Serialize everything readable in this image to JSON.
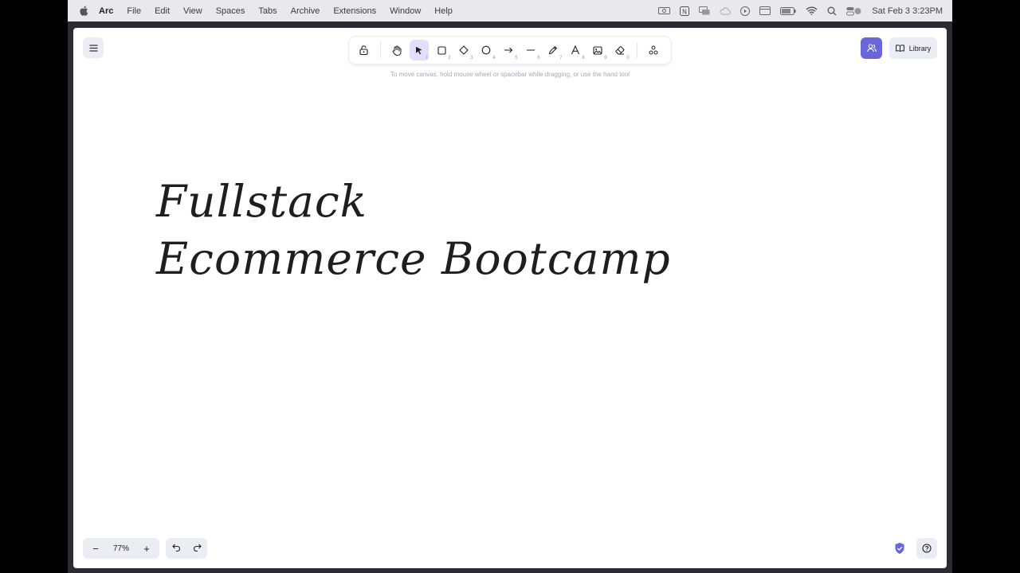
{
  "menubar": {
    "app": "Arc",
    "items": [
      "File",
      "Edit",
      "View",
      "Spaces",
      "Tabs",
      "Archive",
      "Extensions",
      "Window",
      "Help"
    ],
    "clock": "Sat Feb 3  3:23PM"
  },
  "toolbar": {
    "tools": [
      {
        "name": "lock-tool",
        "icon": "lock-icon",
        "key": ""
      },
      {
        "name": "hand-tool",
        "icon": "hand-icon",
        "key": ""
      },
      {
        "name": "selection-tool",
        "icon": "pointer-icon",
        "key": "1",
        "active": true
      },
      {
        "name": "rectangle-tool",
        "icon": "square-icon",
        "key": "2"
      },
      {
        "name": "diamond-tool",
        "icon": "diamond-icon",
        "key": "3"
      },
      {
        "name": "ellipse-tool",
        "icon": "circle-icon",
        "key": "4"
      },
      {
        "name": "arrow-tool",
        "icon": "arrow-icon",
        "key": "5"
      },
      {
        "name": "line-tool",
        "icon": "line-icon",
        "key": "6"
      },
      {
        "name": "draw-tool",
        "icon": "pencil-icon",
        "key": "7"
      },
      {
        "name": "text-tool",
        "icon": "text-icon",
        "key": "8"
      },
      {
        "name": "image-tool",
        "icon": "image-icon",
        "key": "9"
      },
      {
        "name": "eraser-tool",
        "icon": "eraser-icon",
        "key": "0"
      },
      {
        "name": "extra-tools",
        "icon": "shapes-icon",
        "key": ""
      }
    ]
  },
  "hint": "To move canvas, hold mouse wheel or spacebar while dragging, or use the hand tool",
  "library_label": "Library",
  "canvas_text": {
    "line1": "Fullstack",
    "line2": "Ecommerce Bootcamp"
  },
  "zoom": {
    "minus": "−",
    "value": "77%",
    "plus": "+"
  },
  "colors": {
    "accent": "#6965db",
    "selected_tool_bg": "#e0dfff",
    "button_bg": "#ececf4"
  }
}
